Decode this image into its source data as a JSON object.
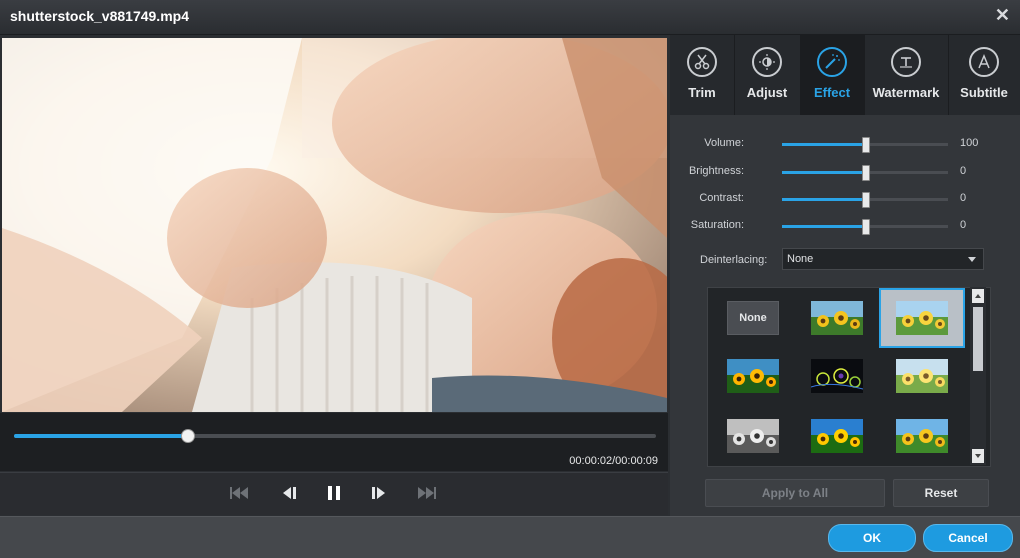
{
  "window": {
    "title": "shutterstock_v881749.mp4",
    "close_glyph": "✕"
  },
  "player": {
    "timecode": "00:00:02/00:00:09",
    "progress": 0.27,
    "controls": [
      "skip-back-icon",
      "step-back-icon",
      "pause-icon",
      "step-forward-icon",
      "skip-forward-icon"
    ]
  },
  "tabs": [
    {
      "label": "Trim",
      "icon": "scissors-icon",
      "active": false
    },
    {
      "label": "Adjust",
      "icon": "adjust-icon",
      "active": false
    },
    {
      "label": "Effect",
      "icon": "magic-wand-icon",
      "active": true
    },
    {
      "label": "Watermark",
      "icon": "watermark-icon",
      "active": false
    },
    {
      "label": "Subtitle",
      "icon": "subtitle-icon",
      "active": false
    }
  ],
  "adjust": {
    "volume": {
      "label": "Volume:",
      "value": "100",
      "level": 0.5
    },
    "brightness": {
      "label": "Brightness:",
      "value": "0",
      "level": 0.5
    },
    "contrast": {
      "label": "Contrast:",
      "value": "0",
      "level": 0.5
    },
    "saturation": {
      "label": "Saturation:",
      "value": "0",
      "level": 0.5
    }
  },
  "deinterlacing": {
    "label": "Deinterlacing:",
    "value": "None"
  },
  "effects": {
    "none_label": "None",
    "selected_index": 2,
    "items": [
      "none",
      "sunflowers-original",
      "sunflowers-selected",
      "sunflowers-warm",
      "sunflowers-edge",
      "sunflowers-bright",
      "sunflowers-grayscale",
      "sunflowers-saturated",
      "sunflowers-sky"
    ]
  },
  "buttons": {
    "apply_all": "Apply to All",
    "reset": "Reset",
    "ok": "OK",
    "cancel": "Cancel"
  },
  "colors": {
    "accent": "#2aa3e6",
    "background": "#2b2e32"
  }
}
